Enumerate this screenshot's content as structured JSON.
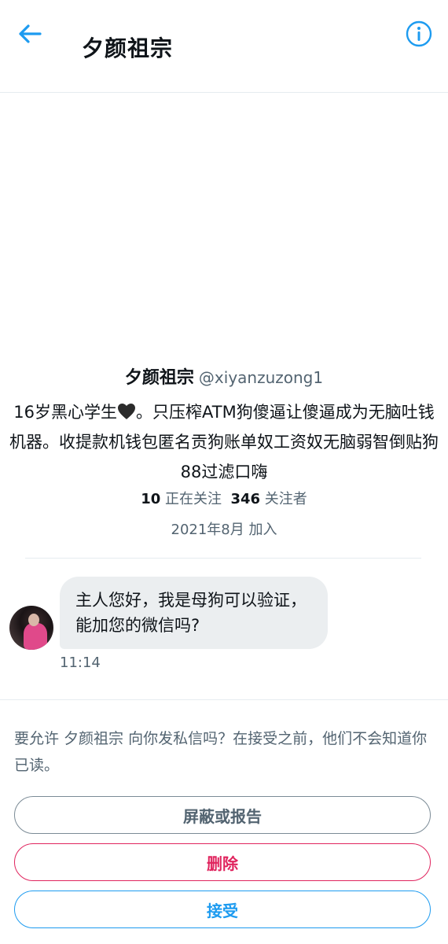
{
  "header": {
    "title": "夕颜祖宗",
    "back_icon": "arrow-left-icon",
    "info_icon": "info-icon"
  },
  "profile": {
    "display_name": "夕颜祖宗",
    "handle": "@xiyanzuzong1",
    "bio_before_heart": "16岁黑心学生",
    "bio_after_heart": "。只压榨ATM狗傻逼让傻逼成为无脑吐钱机器。收提款机钱包匿名贡狗账单奴工资奴无脑弱智倒贴狗88过滤口嗨",
    "heart_icon": "black-heart-icon",
    "following_count": "10",
    "following_label": "正在关注",
    "followers_count": "346",
    "followers_label": "关注者",
    "joined": "2021年8月 加入"
  },
  "message": {
    "text": "主人您好，我是母狗可以验证，能加您的微信吗?",
    "time": "11:14"
  },
  "request": {
    "text": "要允许 夕颜祖宗 向你发私信吗？在接受之前，他们不会知道你已读。",
    "block_label": "屏蔽或报告",
    "delete_label": "删除",
    "accept_label": "接受"
  },
  "colors": {
    "accent": "#1d9bf0",
    "danger": "#e0245e",
    "muted": "#536471",
    "bubble": "#ebeef0"
  }
}
